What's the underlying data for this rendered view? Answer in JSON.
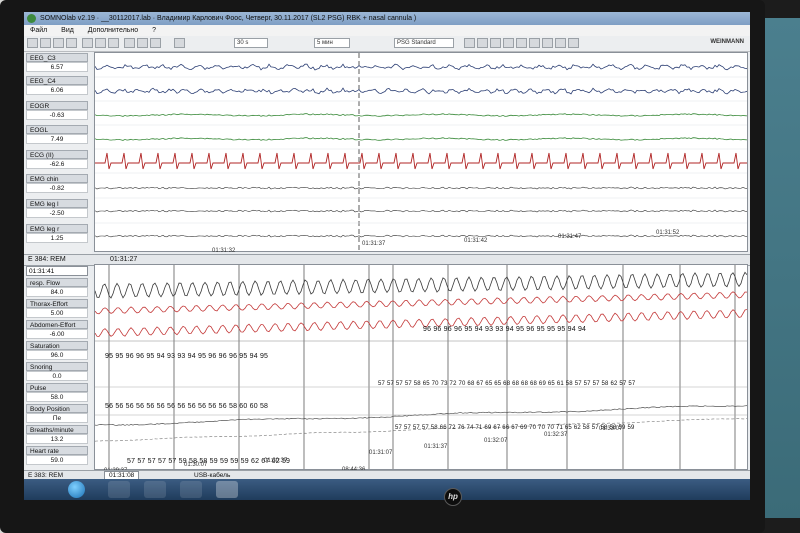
{
  "window_title": "SOMNOlab v2.19 · __30112017.lab · Владимир Карлович Фоос, Четверг, 30.11.2017 (SL2 PSG) RBK + nasal cannula )",
  "menu": [
    "Файл",
    "Вид",
    "Дополнительно",
    "?"
  ],
  "toolbar": {
    "timebase": "30 s",
    "montage": "PSG Standard",
    "count": "5 мин",
    "brand": "WEINMANN"
  },
  "upper_channels": [
    {
      "name": "EEG_C3",
      "value": "6.57"
    },
    {
      "name": "EEG_C4",
      "value": "6.06"
    },
    {
      "name": "EOGR",
      "value": "-0.63"
    },
    {
      "name": "EOGL",
      "value": "7.49"
    },
    {
      "name": "ECG (II)",
      "value": "-62.6"
    },
    {
      "name": "EMG chin",
      "value": "-0.82"
    },
    {
      "name": "EMG leg l",
      "value": "-2.50"
    },
    {
      "name": "EMG leg r",
      "value": "1.25"
    }
  ],
  "upper_times": [
    "01:31:27",
    "01:31:32",
    "01:31:37",
    "01:31:42",
    "01:31:47",
    "01:31:52"
  ],
  "epoch1": {
    "label": "E 384: REM",
    "time": "01:31:41"
  },
  "lower_channels": [
    {
      "name": "resp. Flow",
      "value": "84.0"
    },
    {
      "name": "Thorax-Effort",
      "value": "5.00"
    },
    {
      "name": "Abdomen-Effort",
      "value": "-6.00"
    },
    {
      "name": "Saturation",
      "value": "96.0"
    },
    {
      "name": "Snoring",
      "value": "0.0"
    },
    {
      "name": "Pulse",
      "value": "58.0"
    },
    {
      "name": "Body Position",
      "value": "Пе"
    },
    {
      "name": "Breaths/minute",
      "value": "13.2"
    },
    {
      "name": "Heart rate",
      "value": "59.0"
    }
  ],
  "saturation_row_left": "95 95 96 96 95 94 93 93 94 95 96 96 96 95 94 95",
  "saturation_row_right": "96 96 96 96 95 94 93 93 94 95 96 95 95 95 94 94",
  "pulse_row_left": "56 56 56 56 56 56 56 56 56 56 56 56 58 60 60 58",
  "pulse_row_right": "57 57 57 57 58 65 70 73 72 70 68 67 65 65 68 68 68 68 69 65 61 58 57 57 57 58 62 57 57",
  "heart_row_left": "57 57 57 57 57 59 58 58 59 59 59 59 62 67 62 59",
  "heart_row_right": "57 57 57 57 58 66 72 76 74 71 69 67 66 67 69 70 70 70 71 65 62 58 57 58 58 59 59",
  "lower_times": [
    "01:29:37",
    "01:30:07",
    "01:30:37",
    "01:31:07",
    "01:31:37",
    "01:32:07",
    "01:32:37",
    "01:33:07"
  ],
  "epoch2": {
    "label": "E 383: REM",
    "time": "01:31:08"
  },
  "status": {
    "device": "USB-кабель",
    "duration": "08:44:36"
  },
  "monitor_brand": "hp"
}
